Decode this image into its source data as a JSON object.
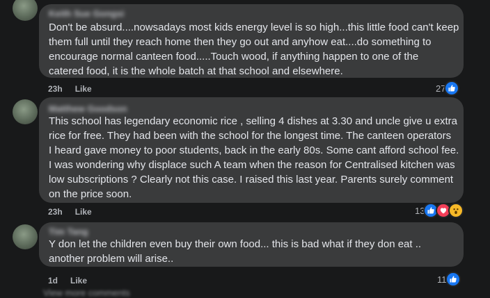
{
  "comments": [
    {
      "author": "Keith Sue Gongsi",
      "lines": [
        "Don't be absurd....nowsadays most kids energy level is so high...this little food can't keep",
        "them full until they reach home then they go out and anyhow eat....do something to",
        "encourage normal canteen food.....Touch wood, if anything happen to one of the",
        "catered food, it is the whole batch at that school and elsewhere."
      ],
      "time": "23h",
      "like_label": "Like",
      "reaction_count": "27",
      "reaction_icons": [
        "like-icon"
      ]
    },
    {
      "author": "Matthew Goodson",
      "lines": [
        "This school has legendary economic rice , selling 4 dishes at 3.30 and uncle give u extra",
        "rice for free. They had been with the school for the longest time. The canteen operators",
        "I heard gave money to poor students, back in the early 80s. Some cant afford school fee.",
        "I was wondering why displace such A team when the reason for Centralised kitchen was",
        "low subscriptions ? Clearly not this case. I raised this last year. Parents surely comment",
        "on the price soon."
      ],
      "time": "23h",
      "like_label": "Like",
      "reaction_count": "13",
      "reaction_icons": [
        "like-icon",
        "love-icon",
        "wow-icon"
      ]
    },
    {
      "author": "Tim Tang",
      "lines": [
        "Y don let the children even buy their own food... this is bad what if they don eat ..",
        "another problem will arise.."
      ],
      "time": "1d",
      "like_label": "Like",
      "reaction_count": "11",
      "reaction_icons": [
        "like-icon"
      ]
    }
  ],
  "footer_partial": "View more comments",
  "colors": {
    "background": "#18191a",
    "bubble": "#3a3b3c",
    "text": "#e4e6eb",
    "meta": "#b0b3b8",
    "like": "#1877f2",
    "love": "#f33e58",
    "wow": "#f7b928"
  }
}
